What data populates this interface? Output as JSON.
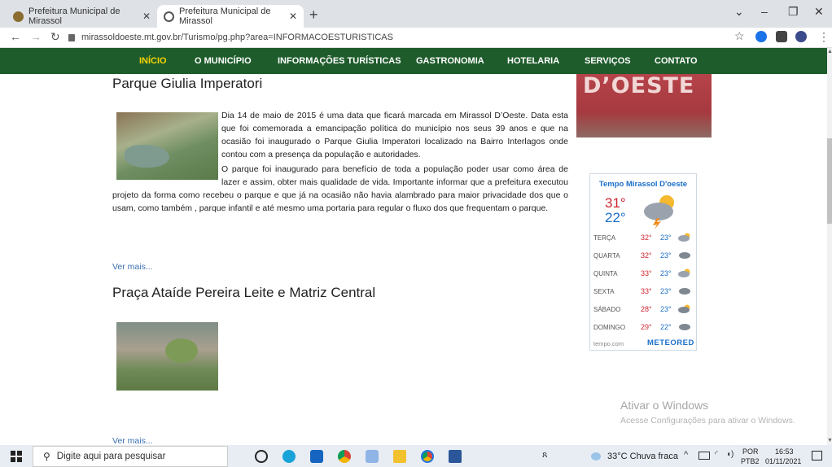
{
  "browser": {
    "tabs": [
      {
        "title": "Prefeitura Municipal de Mirassol"
      },
      {
        "title": "Prefeitura Municipal de Mirassol"
      }
    ],
    "url": "mirassoldoeste.mt.gov.br/Turismo/pg.php?area=INFORMACOESTURISTICAS"
  },
  "nav": {
    "items": [
      "INÍCIO",
      "O MUNICÍPIO",
      "INFORMAÇÕES TURÍSTICAS",
      "GASTRONOMIA",
      "HOTELARIA",
      "SERVIÇOS",
      "CONTATO"
    ]
  },
  "articles": [
    {
      "title": "Parque Giulia Imperatori",
      "p1": "Dia 14 de maio de 2015 é uma data que ficará marcada em Mirassol D’Oeste. Data esta que foi comemorada a emancipação política do município nos seus 39 anos e que na ocasião foi inaugurado o Parque Giulia Imperatori localizado na Bairro Interlagos onde contou com a presença da população e autoridades.",
      "p2a": "O parque foi inaugurado para benefício de toda a população poder usar como área de lazer e assim, obter mais qualidade de vida.  Importante informar que a prefeitura  executou o",
      "p2b": "projeto da forma como recebeu o parque e que já  na ocasião não havia alambrado para maior privacidade dos que o usam, como também , parque infantil e até mesmo uma portaria para regular o fluxo dos que frequentam o parque.",
      "more": "Ver mais..."
    },
    {
      "title": "Praça Ataíde Pereira Leite e Matriz Central",
      "more": "Ver mais..."
    }
  ],
  "banner": {
    "text": "D’OESTE"
  },
  "weather": {
    "title": "Tempo Mirassol D'oeste",
    "now_high": "31°",
    "now_low": "22°",
    "days": [
      {
        "day": "TERÇA",
        "hi": "32°",
        "lo": "23°"
      },
      {
        "day": "QUARTA",
        "hi": "32°",
        "lo": "23°"
      },
      {
        "day": "QUINTA",
        "hi": "33°",
        "lo": "23°"
      },
      {
        "day": "SEXTA",
        "hi": "33°",
        "lo": "23°"
      },
      {
        "day": "SÁBADO",
        "hi": "28°",
        "lo": "23°"
      },
      {
        "day": "DOMINGO",
        "hi": "29°",
        "lo": "22°"
      }
    ],
    "source": "tempo.com",
    "brand": "METEORED"
  },
  "watermark": {
    "line1": "Ativar o Windows",
    "line2": "Acesse Configurações para ativar o Windows."
  },
  "taskbar": {
    "search_placeholder": "Digite aqui para pesquisar",
    "weather": "33°C  Chuva fraca",
    "lang1": "POR",
    "lang2": "PTB2",
    "time": "16:53",
    "date": "01/11/2021"
  },
  "colors": {
    "nav_bg": "#1f5c2c",
    "nav_active": "#f5d400",
    "link": "#3a6fb0",
    "hot": "#d0252f",
    "cold": "#1a6fc9"
  }
}
